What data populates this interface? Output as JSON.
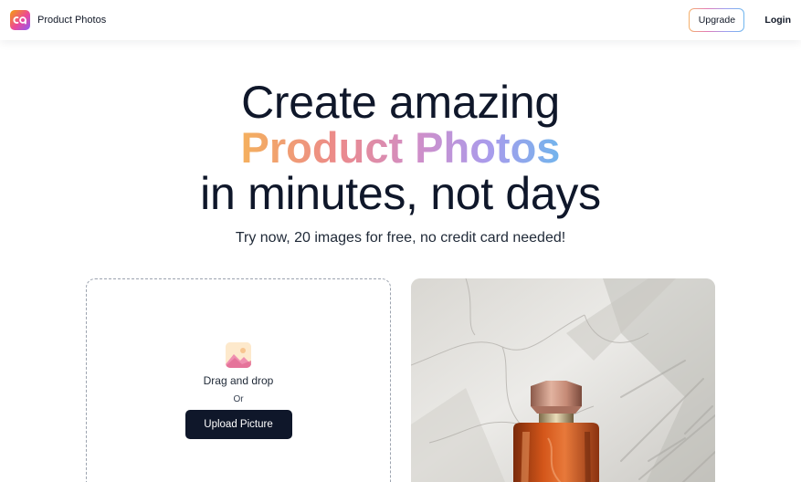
{
  "header": {
    "brand_name": "Product Photos",
    "upgrade_label": "Upgrade",
    "login_label": "Login"
  },
  "hero": {
    "line1": "Create amazing",
    "line2": "Product Photos",
    "line3": "in minutes, not days",
    "subtitle": "Try now, 20 images for free, no credit card needed!"
  },
  "upload": {
    "icon": "image-icon",
    "drag_text": "Drag and drop",
    "or_text": "Or",
    "button_label": "Upload Picture"
  },
  "preview": {
    "subject": "perfume-bottle-on-marble"
  },
  "colors": {
    "brand_gradient_start": "#f4b05e",
    "brand_gradient_end": "#72b4ec",
    "primary_button": "#0f172a"
  }
}
